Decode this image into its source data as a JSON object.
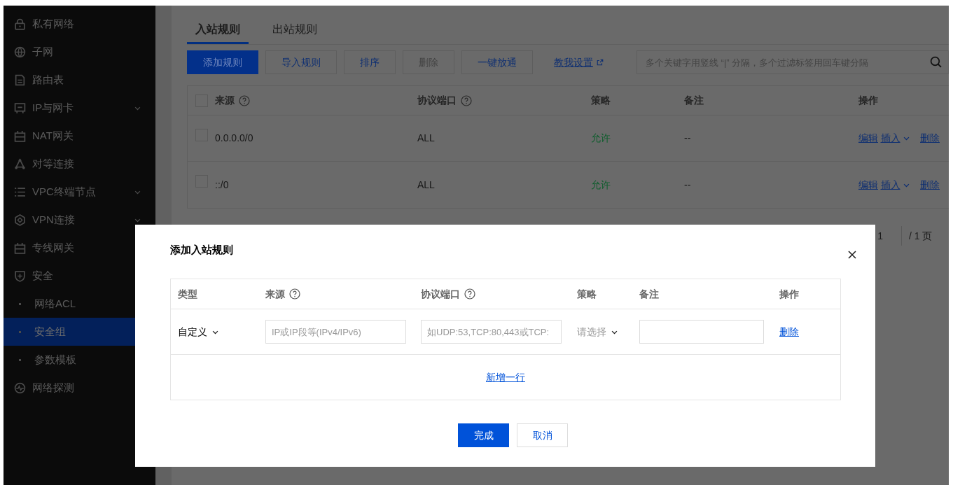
{
  "sidebar": {
    "items": [
      {
        "label": "私有网络",
        "selected": false
      },
      {
        "label": "子网",
        "selected": false
      },
      {
        "label": "路由表",
        "selected": false
      },
      {
        "label": "IP与网卡",
        "selected": false,
        "expanded": false
      },
      {
        "label": "NAT网关",
        "selected": false
      },
      {
        "label": "对等连接",
        "selected": false
      },
      {
        "label": "VPC终端节点",
        "selected": false,
        "expanded": false
      },
      {
        "label": "VPN连接",
        "selected": false,
        "expanded": false
      },
      {
        "label": "专线网关",
        "selected": false
      },
      {
        "label": "安全",
        "selected": false,
        "children": [
          {
            "label": "网络ACL",
            "selected": false
          },
          {
            "label": "安全组",
            "selected": true
          },
          {
            "label": "参数模板",
            "selected": false
          }
        ]
      },
      {
        "label": "网络探测",
        "selected": false
      }
    ]
  },
  "tabs": [
    {
      "label": "入站规则",
      "selected": true
    },
    {
      "label": "出站规则",
      "selected": false
    }
  ],
  "toolbar": {
    "buttons": [
      {
        "label": "添加规则",
        "kind": "primary",
        "disabled": false
      },
      {
        "label": "导入规则",
        "kind": "default",
        "disabled": false
      },
      {
        "label": "排序",
        "kind": "default",
        "disabled": false
      },
      {
        "label": "删除",
        "kind": "default",
        "disabled": true
      },
      {
        "label": "一键放通",
        "kind": "default",
        "disabled": false
      },
      {
        "label": "教我设置",
        "kind": "external-link",
        "disabled": false
      }
    ],
    "search": {
      "placeholder": "多个关键字用竖线 “|” 分隔，多个过滤标签用回车键分隔"
    }
  },
  "table": {
    "select_all": {
      "checked": false
    },
    "columns": [
      {
        "label": "来源",
        "help": true
      },
      {
        "label": "协议端口",
        "help": true
      },
      {
        "label": "策略",
        "help": false
      },
      {
        "label": "备注",
        "help": false
      },
      {
        "label": "操作",
        "help": false
      }
    ],
    "rows": [
      {
        "checked": false,
        "source": "0.0.0.0/0",
        "port": "ALL",
        "policy": "允许",
        "note": "--",
        "actions": [
          {
            "label": "编辑",
            "kind": "link"
          },
          {
            "label": "插入",
            "kind": "dropdown"
          },
          {
            "label": "删除",
            "kind": "link"
          }
        ]
      },
      {
        "checked": false,
        "source": "::/0",
        "port": "ALL",
        "policy": "允许",
        "note": "--",
        "actions": [
          {
            "label": "编辑",
            "kind": "link"
          },
          {
            "label": "插入",
            "kind": "dropdown"
          },
          {
            "label": "删除",
            "kind": "link"
          }
        ]
      }
    ]
  },
  "pagination": {
    "page": "1",
    "total": "/ 1 页"
  },
  "dialog": {
    "title": "添加入站规则",
    "columns": [
      {
        "label": "类型",
        "help": false
      },
      {
        "label": "来源",
        "help": true
      },
      {
        "label": "协议端口",
        "help": true
      },
      {
        "label": "策略",
        "help": false
      },
      {
        "label": "备注",
        "help": false
      },
      {
        "label": "操作",
        "help": false
      }
    ],
    "rows": [
      {
        "type": "自定义",
        "source_placeholder": "IP或IP段等(IPv4/IPv6)",
        "port_placeholder": "如UDP:53,TCP:80,443或TCP:",
        "policy_placeholder": "请选择",
        "action": "删除"
      }
    ],
    "add_row": "新增一行",
    "buttons": [
      {
        "label": "完成",
        "kind": "primary"
      },
      {
        "label": "取消",
        "kind": "default"
      }
    ]
  }
}
